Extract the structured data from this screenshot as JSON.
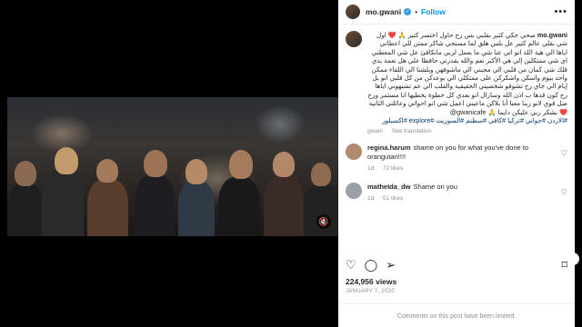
{
  "header": {
    "username": "mo.gwani",
    "follow_label": "Follow",
    "separator": "•",
    "more_label": "•••"
  },
  "caption": {
    "username": "mo.gwani",
    "text": "ﺻﺤﻲ ﺣﻜﻲ ﻛﺘﻴﺮ ﺑﻘﻠﺒﻲ ﺑﺲ رح ﺣﺎول اﺧﺘﺼﺮ ﻛﺘﻴﺮ 🙏 ❤️ اول ﺷﻲ بقلي عالم كتير عل بلس هلق لما مستحي شاكر ممتن للي اعطاني اياها الي هية اللة انو اتي عنا شي ما بعمل لربي مانكافئ عل شي المعطني اي شي ممتكلين إلي هي الأكبر نعم والله بقدرني حافظا علي هل نعمة بدي قلك شي كمان من قلبي الي محبني الي ماشوفهن وبلشنا الي اللقاء ممكن واحد بيوم واسكن واشكركن على ممتكلي الي بوعدكن من كل قلبي انو بل إيام الي جاي رح تشوفو شخصيتي الحقيقية والقلب الي عم تشبهوني اياها رح كون قدها ب اذن الله وسازال انو بعدي كل خطوة بخطيها انا مستمر ورح ضل قوي لانو ربنا معنا أنا بلاكن ماعيني اعمل شي انو احواتي وعائلتي الثانية ❤️ بشكر ربي عليكن دايما 🙏 gwanicafe@",
    "hashtags": "#الاردن #جواني #تركيا #كافي #سطنم #السوريت #explore #اكسبلور",
    "age": "gwani",
    "see_translation": "See translation"
  },
  "comments": [
    {
      "username": "regina.harum",
      "text": "shame on you for what you've done to orangutan!!!!",
      "age": "1d",
      "likes": "72 likes",
      "color": "#b08a6e"
    },
    {
      "username": "matheIda_dw",
      "text": "Shame on you",
      "age": "1d",
      "likes": "51 likes",
      "color": "#9aa0a6"
    }
  ],
  "post": {
    "likes": "224,956 views",
    "date": "January 7, 2020",
    "comments_limited": "Comments on this post have been limited."
  },
  "icons": {
    "heart": "♡",
    "comment": "◯",
    "share": "➢",
    "save": "⌑",
    "close": "✕",
    "next": "›",
    "prev": "‹",
    "mute": "🔇",
    "verified": "✓"
  },
  "colors": {
    "accent": "#0095f6",
    "verified": "#3897f0"
  }
}
